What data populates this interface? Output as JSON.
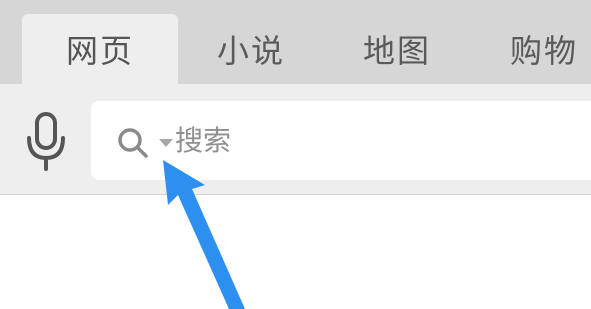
{
  "tabs": [
    {
      "label": "网页",
      "active": true
    },
    {
      "label": "小说",
      "active": false
    },
    {
      "label": "地图",
      "active": false
    },
    {
      "label": "购物",
      "active": false
    }
  ],
  "search": {
    "placeholder": "搜索"
  },
  "icons": {
    "mic": "microphone-icon",
    "search": "search-icon",
    "caret": "caret-down-icon"
  },
  "colors": {
    "tabbar_bg": "#d6d6d6",
    "active_tab_bg": "#eeeeee",
    "arrow": "#2d8ff0"
  }
}
